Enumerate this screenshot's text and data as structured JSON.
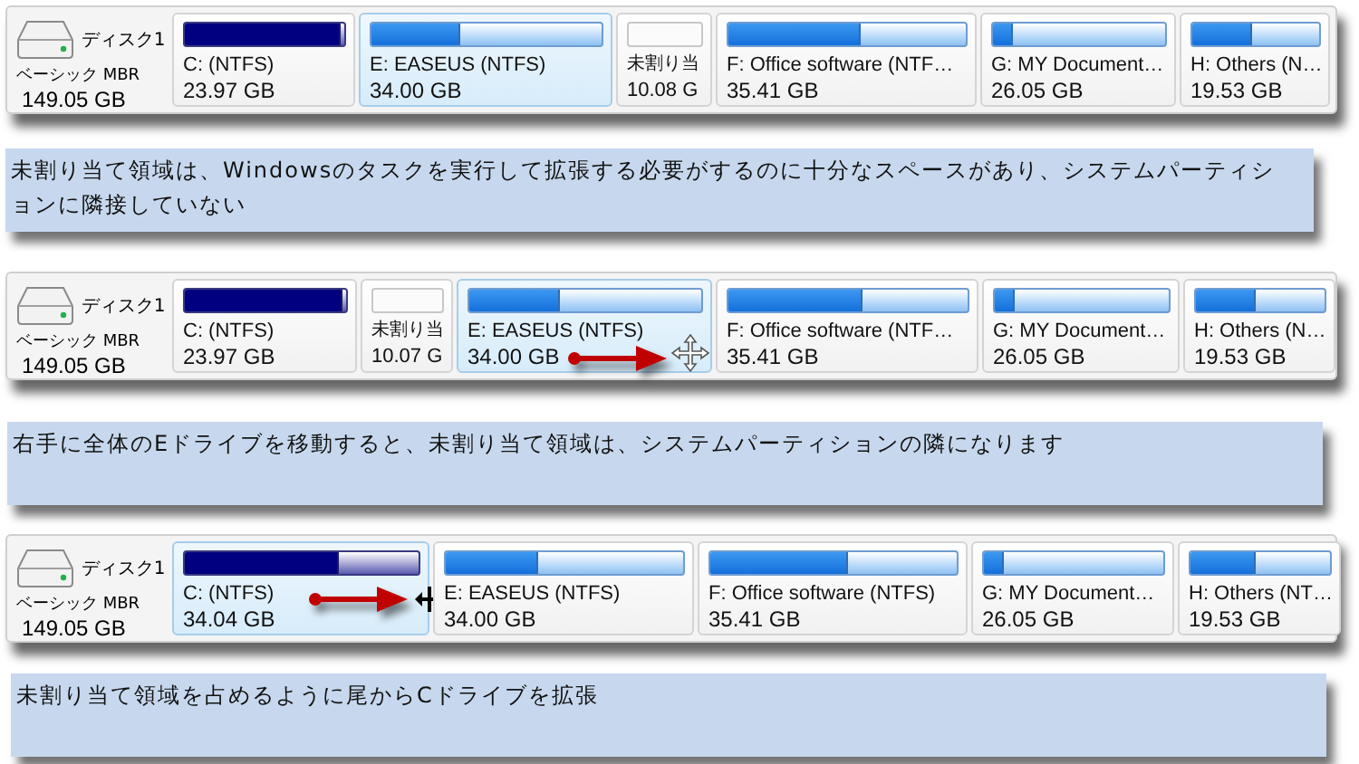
{
  "steps": [
    {
      "disk": {
        "name": "ディスク1",
        "type": "ベーシック MBR",
        "size": "149.05 GB"
      },
      "partitions": [
        {
          "kind": "primary",
          "label": "C: (NTFS)",
          "size": "23.97 GB",
          "level": 0.97,
          "selected": false
        },
        {
          "kind": "logical",
          "label": "E: EASEUS (NTFS)",
          "size": "34.00 GB",
          "level": 0.38,
          "selected": true
        },
        {
          "kind": "unallocated",
          "label": "未割り当",
          "size": "10.08 G",
          "selected": false
        },
        {
          "kind": "logical",
          "label": "F: Office software (NTF…",
          "size": "35.41 GB",
          "level": 0.55,
          "selected": false
        },
        {
          "kind": "logical",
          "label": "G: MY Document…",
          "size": "26.05 GB",
          "level": 0.1,
          "selected": false
        },
        {
          "kind": "logical",
          "label": "H: Others (N…",
          "size": "19.53 GB",
          "level": 0.45,
          "selected": false
        }
      ],
      "note": "未割り当て領域は、Windowsのタスクを実行して拡張する必要がするのに十分なスペースがあり、システムパーティションに隣接していない"
    },
    {
      "disk": {
        "name": "ディスク1",
        "type": "ベーシック MBR",
        "size": "149.05 GB"
      },
      "partitions": [
        {
          "kind": "primary",
          "label": "C: (NTFS)",
          "size": "23.97 GB",
          "level": 0.97,
          "selected": false
        },
        {
          "kind": "unallocated",
          "label": "未割り当",
          "size": "10.07 G",
          "selected": false
        },
        {
          "kind": "logical",
          "label": "E: EASEUS (NTFS)",
          "size": "34.00 GB",
          "level": 0.38,
          "selected": true,
          "dragged": true
        },
        {
          "kind": "logical",
          "label": "F: Office software (NTF…",
          "size": "35.41 GB",
          "level": 0.55,
          "selected": false
        },
        {
          "kind": "logical",
          "label": "G: MY Document…",
          "size": "26.05 GB",
          "level": 0.1,
          "selected": false
        },
        {
          "kind": "logical",
          "label": "H: Others (N…",
          "size": "19.53 GB",
          "level": 0.45,
          "selected": false
        }
      ],
      "note": "右手に全体のEドライブを移動すると、未割り当て領域は、システムパーティションの隣になります"
    },
    {
      "disk": {
        "name": "ディスク1",
        "type": "ベーシック MBR",
        "size": "149.05 GB"
      },
      "partitions": [
        {
          "kind": "primary",
          "label": "C: (NTFS)",
          "size": "34.04 GB",
          "level": 0.65,
          "selected": true,
          "resized": true
        },
        {
          "kind": "logical",
          "label": "E: EASEUS (NTFS)",
          "size": "34.00 GB",
          "level": 0.38,
          "selected": false
        },
        {
          "kind": "logical",
          "label": "F: Office software (NTFS)",
          "size": "35.41 GB",
          "level": 0.55,
          "selected": false
        },
        {
          "kind": "logical",
          "label": "G: MY Document…",
          "size": "26.05 GB",
          "level": 0.1,
          "selected": false
        },
        {
          "kind": "logical",
          "label": "H: Others (NT…",
          "size": "19.53 GB",
          "level": 0.45,
          "selected": false
        }
      ],
      "note": "未割り当て領域を占めるように尾からCドライブを拡張"
    }
  ]
}
